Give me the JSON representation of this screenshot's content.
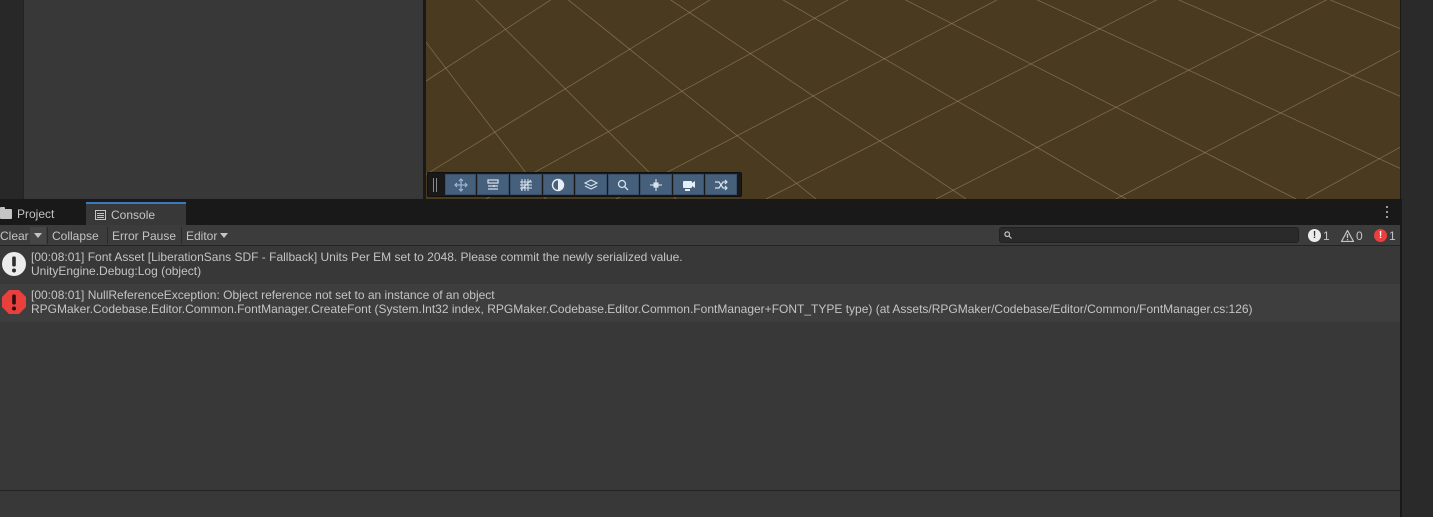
{
  "tabs": {
    "project_label": "Project",
    "console_label": "Console"
  },
  "toolbar": {
    "clear_label": "Clear",
    "collapse_label": "Collapse",
    "error_pause_label": "Error Pause",
    "editor_label": "Editor",
    "search_placeholder": "",
    "info_count": "1",
    "warning_count": "0",
    "error_count": "1"
  },
  "scene_toolbar": {
    "icons": [
      "move-tool-icon",
      "toggle-icon",
      "grid-icon",
      "shading-icon",
      "layers-icon",
      "search-icon",
      "gizmo-icon",
      "camera-icon",
      "shuffle-icon"
    ]
  },
  "logs": [
    {
      "type": "info",
      "line1": "[00:08:01] Font Asset [LiberationSans SDF - Fallback] Units Per EM set to 2048. Please commit the newly serialized value.",
      "line2": "UnityEngine.Debug:Log (object)"
    },
    {
      "type": "error",
      "line1": "[00:08:01] NullReferenceException: Object reference not set to an instance of an object",
      "line2": "RPGMaker.Codebase.Editor.Common.FontManager.CreateFont (System.Int32 index, RPGMaker.Codebase.Editor.Common.FontManager+FONT_TYPE type) (at Assets/RPGMaker/Codebase/Editor/Common/FontManager.cs:126)"
    }
  ],
  "colors": {
    "scene_background": "#4a3a1f",
    "tab_accent": "#3a79bb",
    "error": "#e9403d",
    "info": "#ececec",
    "toolbar_button": "#46607c"
  }
}
